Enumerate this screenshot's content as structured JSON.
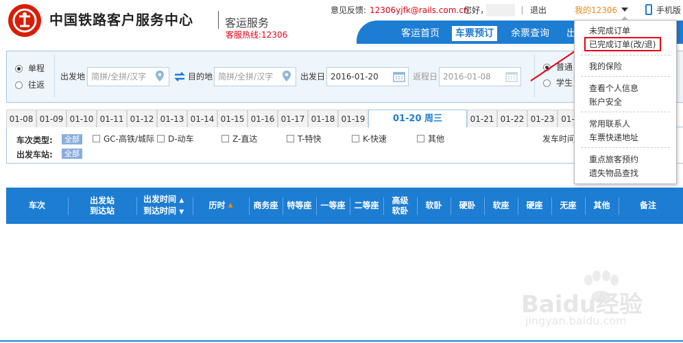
{
  "header": {
    "logo_title": "中国铁路客户服务中心",
    "logo_subtitle": "客运服务",
    "hotline": "客服热线:12306",
    "feedback_label": "意见反馈:",
    "feedback_email": "12306yjfk@rails.com.cn",
    "greeting": "您好，",
    "logout": "退出",
    "my_account": "我的12306",
    "mobile": "手机版"
  },
  "nav": {
    "items": [
      {
        "label": "客运首页"
      },
      {
        "label": "车票预订"
      },
      {
        "label": "余票查询"
      },
      {
        "label": "出"
      }
    ]
  },
  "search": {
    "one_way": "单程",
    "round_trip": "往返",
    "from_label": "出发地",
    "from_placeholder": "简拼/全拼/汉字",
    "to_label": "目的地",
    "to_placeholder": "简拼/全拼/汉字",
    "depart_label": "出发日",
    "depart_value": "2016-01-20",
    "return_label": "返程日",
    "return_value": "2016-01-08",
    "type_normal": "普通",
    "type_student": "学生"
  },
  "date_tabs": [
    "01-08",
    "01-09",
    "01-10",
    "01-11",
    "01-12",
    "01-13",
    "01-14",
    "01-15",
    "01-16",
    "01-17",
    "01-18",
    "01-19",
    "01-20 周三",
    "01-21",
    "01-22",
    "01-23",
    "01-"
  ],
  "filters": {
    "train_type_label": "车次类型:",
    "all": "全部",
    "types": [
      "GC-高铁/城际",
      "D-动车",
      "Z-直达",
      "T-特快",
      "K-快速",
      "其他"
    ],
    "station_label": "出发车站:",
    "depart_time_label": "发车时间"
  },
  "table_headers": {
    "train": "车次",
    "stations_1": "出发站",
    "stations_2": "到达站",
    "times_1": "出发时间",
    "times_2": "到达时间",
    "duration": "历时",
    "business": "商务座",
    "special": "特等座",
    "first": "一等座",
    "second": "二等座",
    "soft_sleeper_hi_1": "高级",
    "soft_sleeper_hi_2": "软卧",
    "soft_sleeper": "软卧",
    "hard_sleeper": "硬卧",
    "soft_seat": "软座",
    "hard_seat": "硬座",
    "no_seat": "无座",
    "other": "其他",
    "remark": "备注"
  },
  "dropdown": {
    "items": [
      "未完成订单",
      "已完成订单(改/退)",
      "我的保险",
      "查看个人信息",
      "账户安全",
      "常用联系人",
      "车票快递地址",
      "重点旅客预约",
      "遗失物品查找"
    ]
  },
  "watermark": {
    "brand": "Baidu经验",
    "url": "jingyan.baidu.com"
  },
  "colors": {
    "brand_blue": "#1c7dd2",
    "accent_red": "#e60012",
    "orange": "#f08519"
  }
}
